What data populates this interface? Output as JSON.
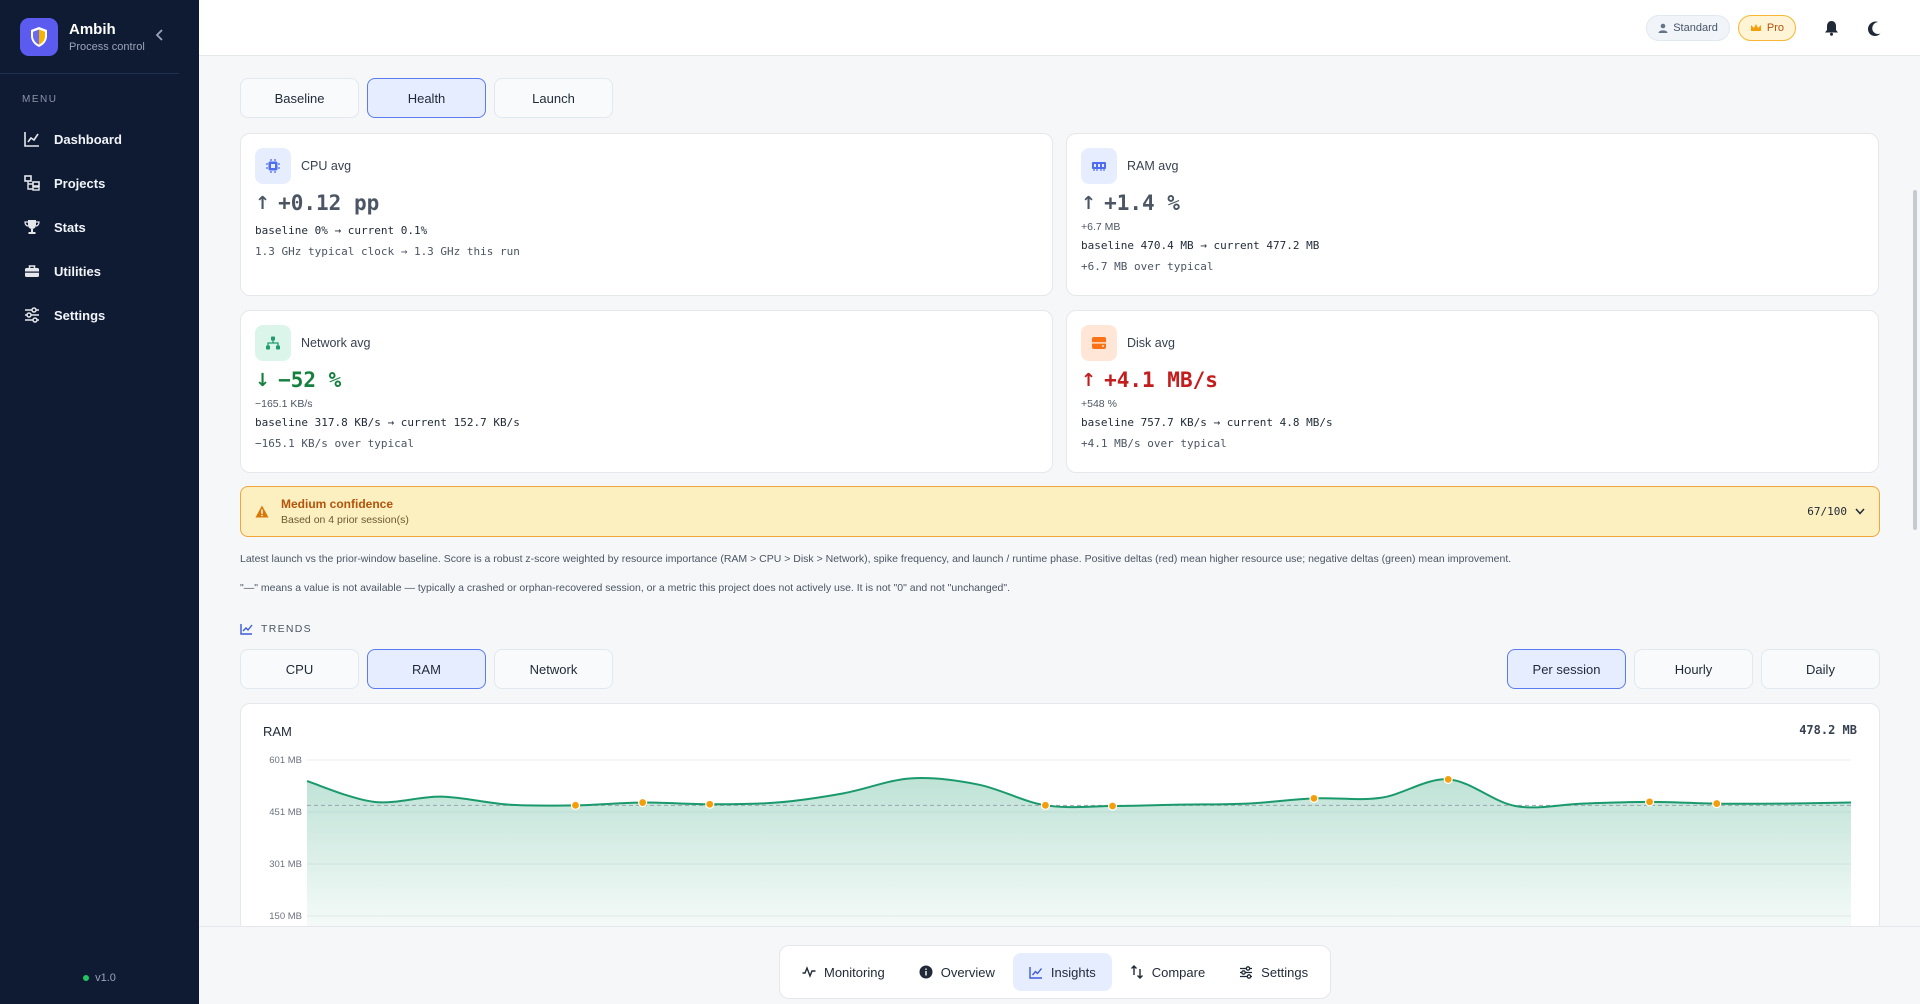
{
  "app": {
    "name": "Ambih",
    "subtitle": "Process control",
    "version": "v1.0"
  },
  "sidebar": {
    "menu_label": "MENU",
    "items": [
      {
        "label": "Dashboard",
        "icon": "chart-line-icon"
      },
      {
        "label": "Projects",
        "icon": "folder-tree-icon"
      },
      {
        "label": "Stats",
        "icon": "trophy-icon"
      },
      {
        "label": "Utilities",
        "icon": "toolbox-icon"
      },
      {
        "label": "Settings",
        "icon": "sliders-icon"
      }
    ]
  },
  "topbar": {
    "standard_label": "Standard",
    "pro_label": "Pro"
  },
  "tabs": [
    "Baseline",
    "Health",
    "Launch"
  ],
  "active_tab": "Health",
  "metrics": {
    "cpu": {
      "title": "CPU avg",
      "delta": "+0.12 pp",
      "line1": "baseline 0% → current 0.1%",
      "line2": "1.3 GHz typical clock → 1.3 GHz this run"
    },
    "ram": {
      "title": "RAM avg",
      "delta": "+1.4 %",
      "small": "+6.7 MB",
      "line1": "baseline 470.4 MB → current 477.2 MB",
      "line2": "+6.7 MB over typical"
    },
    "network": {
      "title": "Network avg",
      "delta": "−52 %",
      "small": "−165.1 KB/s",
      "line1": "baseline 317.8 KB/s → current 152.7 KB/s",
      "line2": "−165.1 KB/s over typical"
    },
    "disk": {
      "title": "Disk avg",
      "delta": "+4.1 MB/s",
      "small": "+548 %",
      "line1": "baseline 757.7 KB/s → current 4.8 MB/s",
      "line2": "+4.1 MB/s over typical"
    }
  },
  "confidence": {
    "title": "Medium confidence",
    "subtitle": "Based on 4 prior session(s)",
    "score": "67/100"
  },
  "notes": {
    "n1": "Latest launch vs the prior-window baseline. Score is a robust z-score weighted by resource importance (RAM > CPU > Disk > Network), spike frequency, and launch / runtime phase. Positive deltas (red) mean higher resource use; negative deltas (green) mean improvement.",
    "n2": "\"—\" means a value is not available — typically a crashed or orphan-recovered session, or a metric this project does not actively use. It is not \"0\" and not \"unchanged\"."
  },
  "trends": {
    "label": "TRENDS",
    "metric_tabs": [
      "CPU",
      "RAM",
      "Network"
    ],
    "active_metric": "RAM",
    "range_tabs": [
      "Per session",
      "Hourly",
      "Daily"
    ],
    "active_range": "Per session"
  },
  "chart_data": {
    "type": "area",
    "title": "RAM",
    "current_value": "478.2 MB",
    "y_ticks": [
      "601 MB",
      "451 MB",
      "301 MB",
      "150 MB"
    ],
    "ylim": [
      150,
      601
    ],
    "baseline": 470,
    "unit": "MB",
    "values": [
      540,
      480,
      495,
      472,
      470,
      478,
      473,
      478,
      505,
      548,
      530,
      470,
      468,
      472,
      475,
      490,
      492,
      545,
      468,
      475,
      480,
      475,
      475,
      478
    ],
    "flagged_indices": [
      4,
      5,
      6,
      11,
      12,
      15,
      17,
      20,
      21
    ],
    "colors": {
      "line": "#1a9a6c",
      "fill": "#1a9a6c",
      "marker": "#f59e0b"
    }
  },
  "bottom_nav": {
    "items": [
      {
        "label": "Monitoring",
        "icon": "pulse-icon"
      },
      {
        "label": "Overview",
        "icon": "info-icon"
      },
      {
        "label": "Insights",
        "icon": "chart-line-icon"
      },
      {
        "label": "Compare",
        "icon": "compare-arrows-icon"
      },
      {
        "label": "Settings",
        "icon": "sliders-icon"
      }
    ],
    "active": "Insights"
  }
}
